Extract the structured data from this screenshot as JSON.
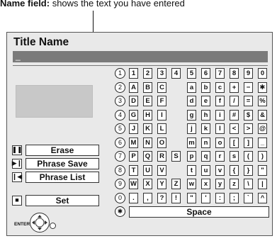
{
  "caption": {
    "bold": "Name field:",
    "text": " shows the text you have entered"
  },
  "title": "Title Name",
  "name_value": "_",
  "controls": [
    {
      "icon": "pause-icon",
      "glyph": "❚❚",
      "label": "Erase"
    },
    {
      "icon": "skip-forward-icon",
      "glyph": "▶❙",
      "label": "Phrase Save"
    },
    {
      "icon": "skip-back-icon",
      "glyph": "❙◀",
      "label": "Phrase List"
    },
    {
      "icon": "stop-icon",
      "glyph": "■",
      "label": "Set"
    }
  ],
  "enter_label": "ENTER",
  "rows": [
    {
      "num": "1",
      "keys": [
        "1",
        "2",
        "3",
        "4",
        "5",
        "6",
        "7",
        "8",
        "9",
        "0"
      ]
    },
    {
      "num": "2",
      "keys": [
        "A",
        "B",
        "C",
        "",
        "a",
        "b",
        "c",
        "+",
        "−",
        "✱"
      ]
    },
    {
      "num": "3",
      "keys": [
        "D",
        "E",
        "F",
        "",
        "d",
        "e",
        "f",
        "/",
        "=",
        "%"
      ]
    },
    {
      "num": "4",
      "keys": [
        "G",
        "H",
        "I",
        "",
        "g",
        "h",
        "i",
        "#",
        "$",
        "&"
      ]
    },
    {
      "num": "5",
      "keys": [
        "J",
        "K",
        "L",
        "",
        "j",
        "k",
        "l",
        "<",
        ">",
        "@"
      ]
    },
    {
      "num": "6",
      "keys": [
        "M",
        "N",
        "O",
        "",
        "m",
        "n",
        "o",
        "[",
        "]",
        "_"
      ]
    },
    {
      "num": "7",
      "keys": [
        "P",
        "Q",
        "R",
        "S",
        "p",
        "q",
        "r",
        "s",
        "(",
        ")"
      ]
    },
    {
      "num": "8",
      "keys": [
        "T",
        "U",
        "V",
        "",
        "t",
        "u",
        "v",
        "{",
        "}",
        "\""
      ]
    },
    {
      "num": "9",
      "keys": [
        "W",
        "X",
        "Y",
        "Z",
        "w",
        "x",
        "y",
        "z",
        "\\",
        "|"
      ]
    },
    {
      "num": "0",
      "keys": [
        ".",
        ",",
        "?",
        "!",
        "\"",
        "'",
        ":",
        ";",
        "`",
        "^"
      ]
    }
  ],
  "space_row": {
    "num": "✱",
    "label": "Space"
  }
}
